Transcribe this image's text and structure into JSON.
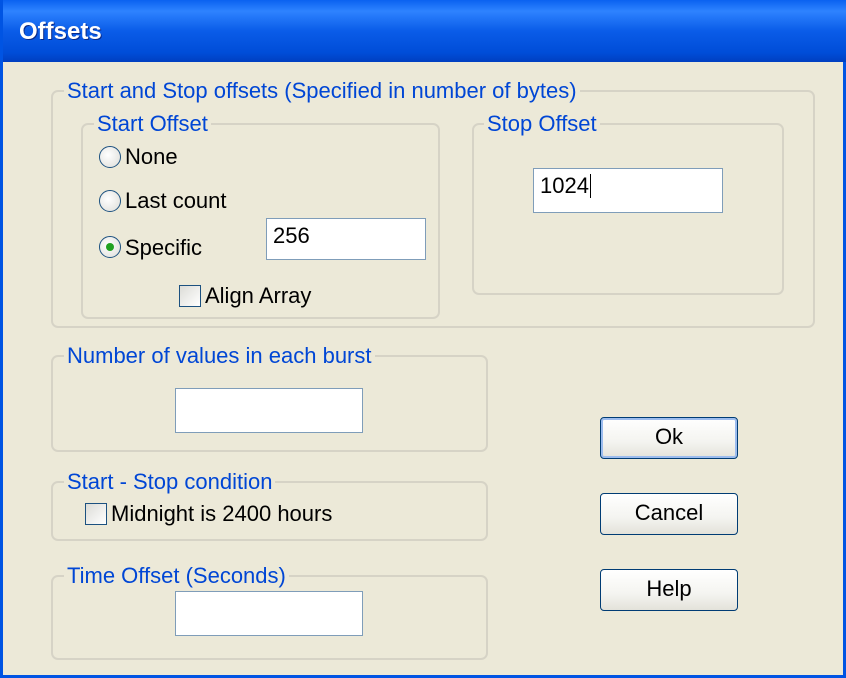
{
  "window": {
    "title": "Offsets"
  },
  "offsets_group": {
    "legend": "Start and Stop offsets (Specified in number of bytes)",
    "start_offset": {
      "legend": "Start Offset",
      "options": [
        {
          "label": "None",
          "checked": false
        },
        {
          "label": "Last count",
          "checked": false
        },
        {
          "label": "Specific",
          "checked": true
        }
      ],
      "specific_value": "256",
      "align_array": {
        "label": "Align Array",
        "checked": false
      }
    },
    "stop_offset": {
      "legend": "Stop Offset",
      "value": "1024"
    }
  },
  "burst_group": {
    "legend": "Number of values in each burst",
    "value": ""
  },
  "start_stop_group": {
    "legend": "Start - Stop condition",
    "midnight": {
      "label": "Midnight is 2400 hours",
      "checked": false
    }
  },
  "time_offset_group": {
    "legend": "Time Offset (Seconds)",
    "value": ""
  },
  "buttons": {
    "ok": "Ok",
    "cancel": "Cancel",
    "help": "Help"
  }
}
